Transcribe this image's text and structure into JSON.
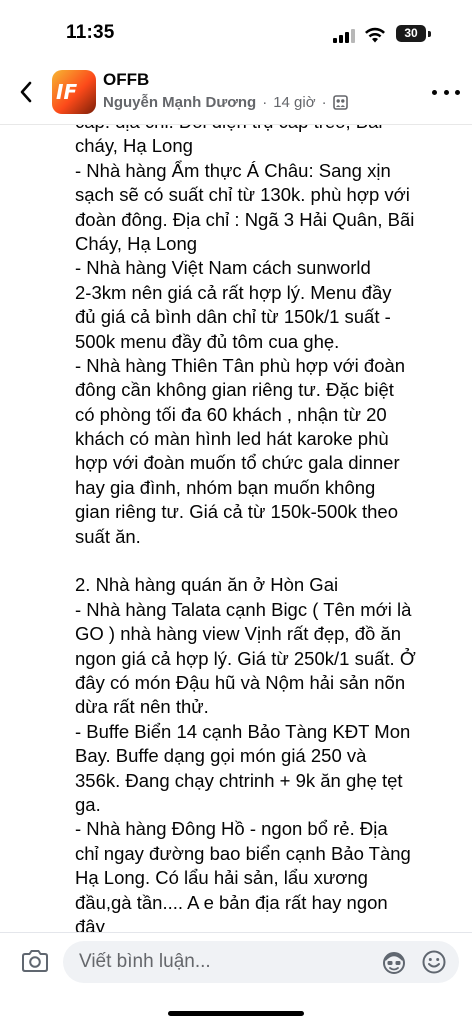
{
  "status_bar": {
    "time": "11:35",
    "battery_level": "30"
  },
  "header": {
    "group_name": "OFFB",
    "author": "Nguyễn Mạnh Dương",
    "time_ago": "14 giờ",
    "avatar_text": "IF",
    "icons": [
      "chevron-left-icon",
      "group-privacy-icon",
      "more-icon"
    ]
  },
  "post": {
    "lines": [
      "cấp: địa chỉ: Đối diện trụ cấp treo, Bãi",
      "cháy, Hạ Long",
      "- Nhà hàng Ẩm thực Á Châu: Sang xịn",
      "sạch sẽ có suất chỉ từ 130k.  phù hợp với",
      "đoàn đông. Địa chỉ : Ngã 3 Hải Quân, Bãi",
      "Cháy, Hạ Long",
      "- Nhà hàng Việt Nam cách sunworld",
      "2-3km nên giá cả rất hợp lý. Menu đầy",
      "đủ giá cả bình dân chỉ từ 150k/1 suất -",
      "500k menu đầy đủ tôm cua ghẹ.",
      "- Nhà hàng Thiên Tân phù hợp với đoàn",
      "đông cần không gian riêng tư. Đặc biệt",
      "có phòng tối đa 60 khách , nhận từ 20",
      "khách có màn hình led hát karoke phù",
      "hợp với đoàn muốn tổ chức gala dinner",
      "hay gia đình, nhóm bạn muốn không",
      "gian riêng tư. Giá cả từ 150k-500k theo",
      "suất ăn.",
      "",
      "2. Nhà hàng quán ăn ở Hòn Gai",
      "- Nhà hàng Talata cạnh Bigc ( Tên mới là",
      "GO ) nhà hàng view Vịnh rất đẹp, đồ ăn",
      "ngon giá cả hợp lý. Giá từ 250k/1 suất. Ở",
      "đây có món Đậu hũ và Nộm hải sản nõn",
      "dừa rất nên thử.",
      "- Buffe Biển 14 cạnh Bảo Tàng KĐT Mon",
      "Bay. Buffe dạng gọi món giá 250 và",
      "356k. Đang chạy chtrinh + 9k ăn ghẹ tẹt",
      "ga.",
      "- Nhà hàng Đông Hồ - ngon bổ rẻ. Địa",
      "chỉ ngay đường bao biển cạnh Bảo Tàng",
      "Hạ Long. Có lẩu hải sản, lẩu xương",
      "đầu,gà tần.... A e bản địa rất hay ngon",
      "đây"
    ]
  },
  "comment_bar": {
    "placeholder": "Viết bình luận...",
    "icons": [
      "camera-icon",
      "avatar-sticker-icon",
      "emoji-icon"
    ]
  }
}
